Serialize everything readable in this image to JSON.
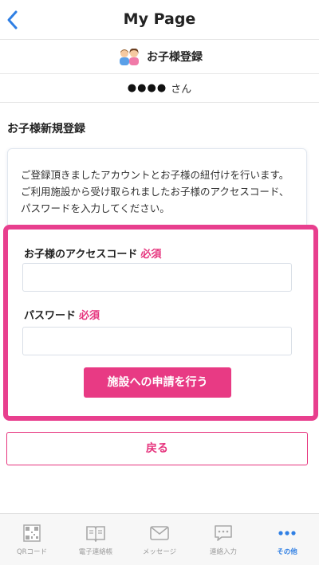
{
  "header": {
    "title": "My Page"
  },
  "subheader": {
    "title": "お子様登録"
  },
  "user": {
    "name_masked": "●●●●",
    "honorific": "さん"
  },
  "section": {
    "title": "お子様新規登録"
  },
  "description": {
    "line1": "ご登録頂きましたアカウントとお子様の紐付けを行います。",
    "line2": "ご利用施設から受け取られましたお子様のアクセスコード、パスワードを入力してください。"
  },
  "form": {
    "access_code_label": "お子様のアクセスコード",
    "password_label": "パスワード",
    "required_label": "必須",
    "access_code_value": "",
    "password_value": "",
    "submit_label": "施設への申請を行う"
  },
  "back_button": {
    "label": "戻る"
  },
  "tabbar": {
    "tabs": [
      {
        "label": "QRコード",
        "icon": "qr-code-icon"
      },
      {
        "label": "電子連絡帳",
        "icon": "book-icon"
      },
      {
        "label": "メッセージ",
        "icon": "mail-icon"
      },
      {
        "label": "連絡入力",
        "icon": "chat-bubble-icon"
      },
      {
        "label": "その他",
        "icon": "more-dots-icon"
      }
    ],
    "active_color": "#2f7fe4",
    "inactive_color": "#9a9a9a"
  },
  "colors": {
    "accent": "#e83a84",
    "link_blue": "#2f7fe4"
  }
}
